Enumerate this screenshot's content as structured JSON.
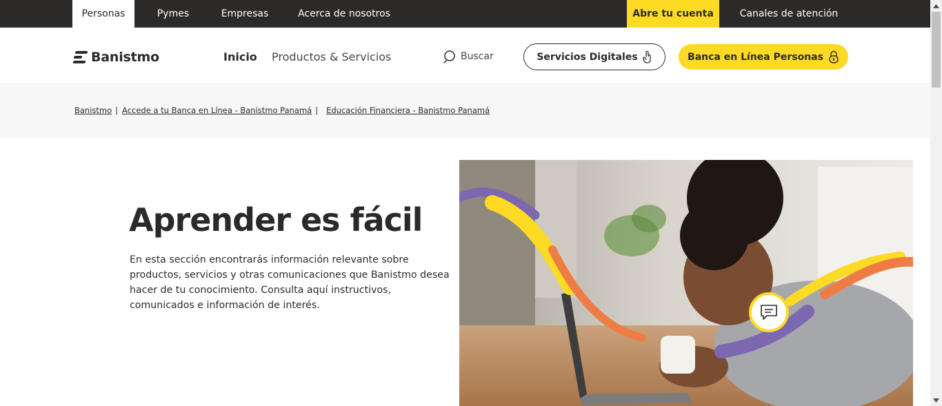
{
  "topbar": {
    "items": [
      {
        "label": "Personas"
      },
      {
        "label": "Pymes"
      },
      {
        "label": "Empresas"
      },
      {
        "label": "Acerca de nosotros"
      },
      {
        "label": "Abre tu cuenta"
      },
      {
        "label": "Canales de atención"
      }
    ]
  },
  "header": {
    "logo_text": "Banistmo",
    "nav": [
      {
        "label": "Inicio"
      },
      {
        "label": "Productos & Servicios"
      }
    ],
    "search_label": "Buscar",
    "digital_button": "Servicios Digitales",
    "banca_button": "Banca en Línea Personas"
  },
  "breadcrumb": [
    {
      "label": "Banistmo"
    },
    {
      "label": "Accede a tu Banca en Línea - Banistmo Panamá"
    },
    {
      "label": "Educación Financiera - Banistmo Panamá"
    }
  ],
  "hero": {
    "title": "Aprender es fácil",
    "text": "En esta sección encontrarás información relevante sobre productos, servicios y otras comunicaciones que Banistmo desea hacer de tu conocimiento. Consulta aquí instructivos, comunicados e información de interés."
  },
  "colors": {
    "brand_yellow": "#fdda24",
    "dark": "#2c2a29",
    "purple": "#7b68b0",
    "orange": "#ee7d45"
  }
}
